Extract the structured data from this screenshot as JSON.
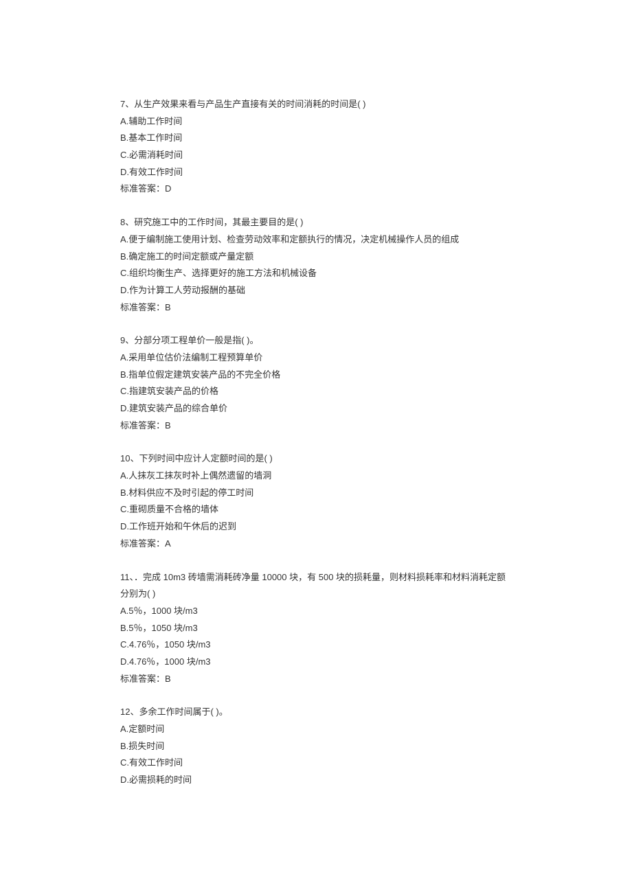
{
  "answer_label_prefix": "标准答案：",
  "questions": [
    {
      "number": "7、",
      "stem": "从生产效果来看与产品生产直接有关的时间消耗的时间是( )",
      "options": [
        "A.辅助工作时间",
        "B.基本工作时间",
        "C.必需消耗时间",
        "D.有效工作时间"
      ],
      "answer": "D"
    },
    {
      "number": "8、",
      "stem": "研究施工中的工作时间，其最主要目的是( )",
      "options": [
        "A.便于编制施工使用计划、检查劳动效率和定额执行的情况，决定机械操作人员的组成",
        "B.确定施工的时间定额或产量定额",
        "C.组织均衡生产、选择更好的施工方法和机械设备",
        "D.作为计算工人劳动报酬的基础"
      ],
      "answer": "B"
    },
    {
      "number": "9、",
      "stem": "分部分项工程单价一般是指( )。",
      "options": [
        "A.采用单位估价法编制工程预算单价",
        "B.指单位假定建筑安装产品的不完全价格",
        "C.指建筑安装产品的价格",
        "D.建筑安装产品的综合单价"
      ],
      "answer": "B"
    },
    {
      "number": "10、",
      "stem": "下列时间中应计人定额时间的是( )",
      "options": [
        "A.人抹灰工抹灰时补上偶然遗留的墙洞",
        "B.材料供应不及时引起的停工时间",
        "C.重砌质量不合格的墙体",
        "D.工作班开始和午休后的迟到"
      ],
      "answer": "A"
    },
    {
      "number": "11、",
      "stem": "．完成 10m3 砖墙需消耗砖净量 10000 块，有 500 块的损耗量，则材料损耗率和材料消耗定额分别为( )",
      "options": [
        "A.5％，1000 块/m3",
        "B.5％，1050 块/m3",
        "C.4.76％，1050 块/m3",
        "D.4.76％，1000 块/m3"
      ],
      "answer": "B"
    },
    {
      "number": "12、",
      "stem": "多余工作时间属于( )。",
      "options": [
        "A.定额时间",
        "B.损失时间",
        "C.有效工作时间",
        "D.必需损耗的时间"
      ],
      "answer": ""
    }
  ]
}
